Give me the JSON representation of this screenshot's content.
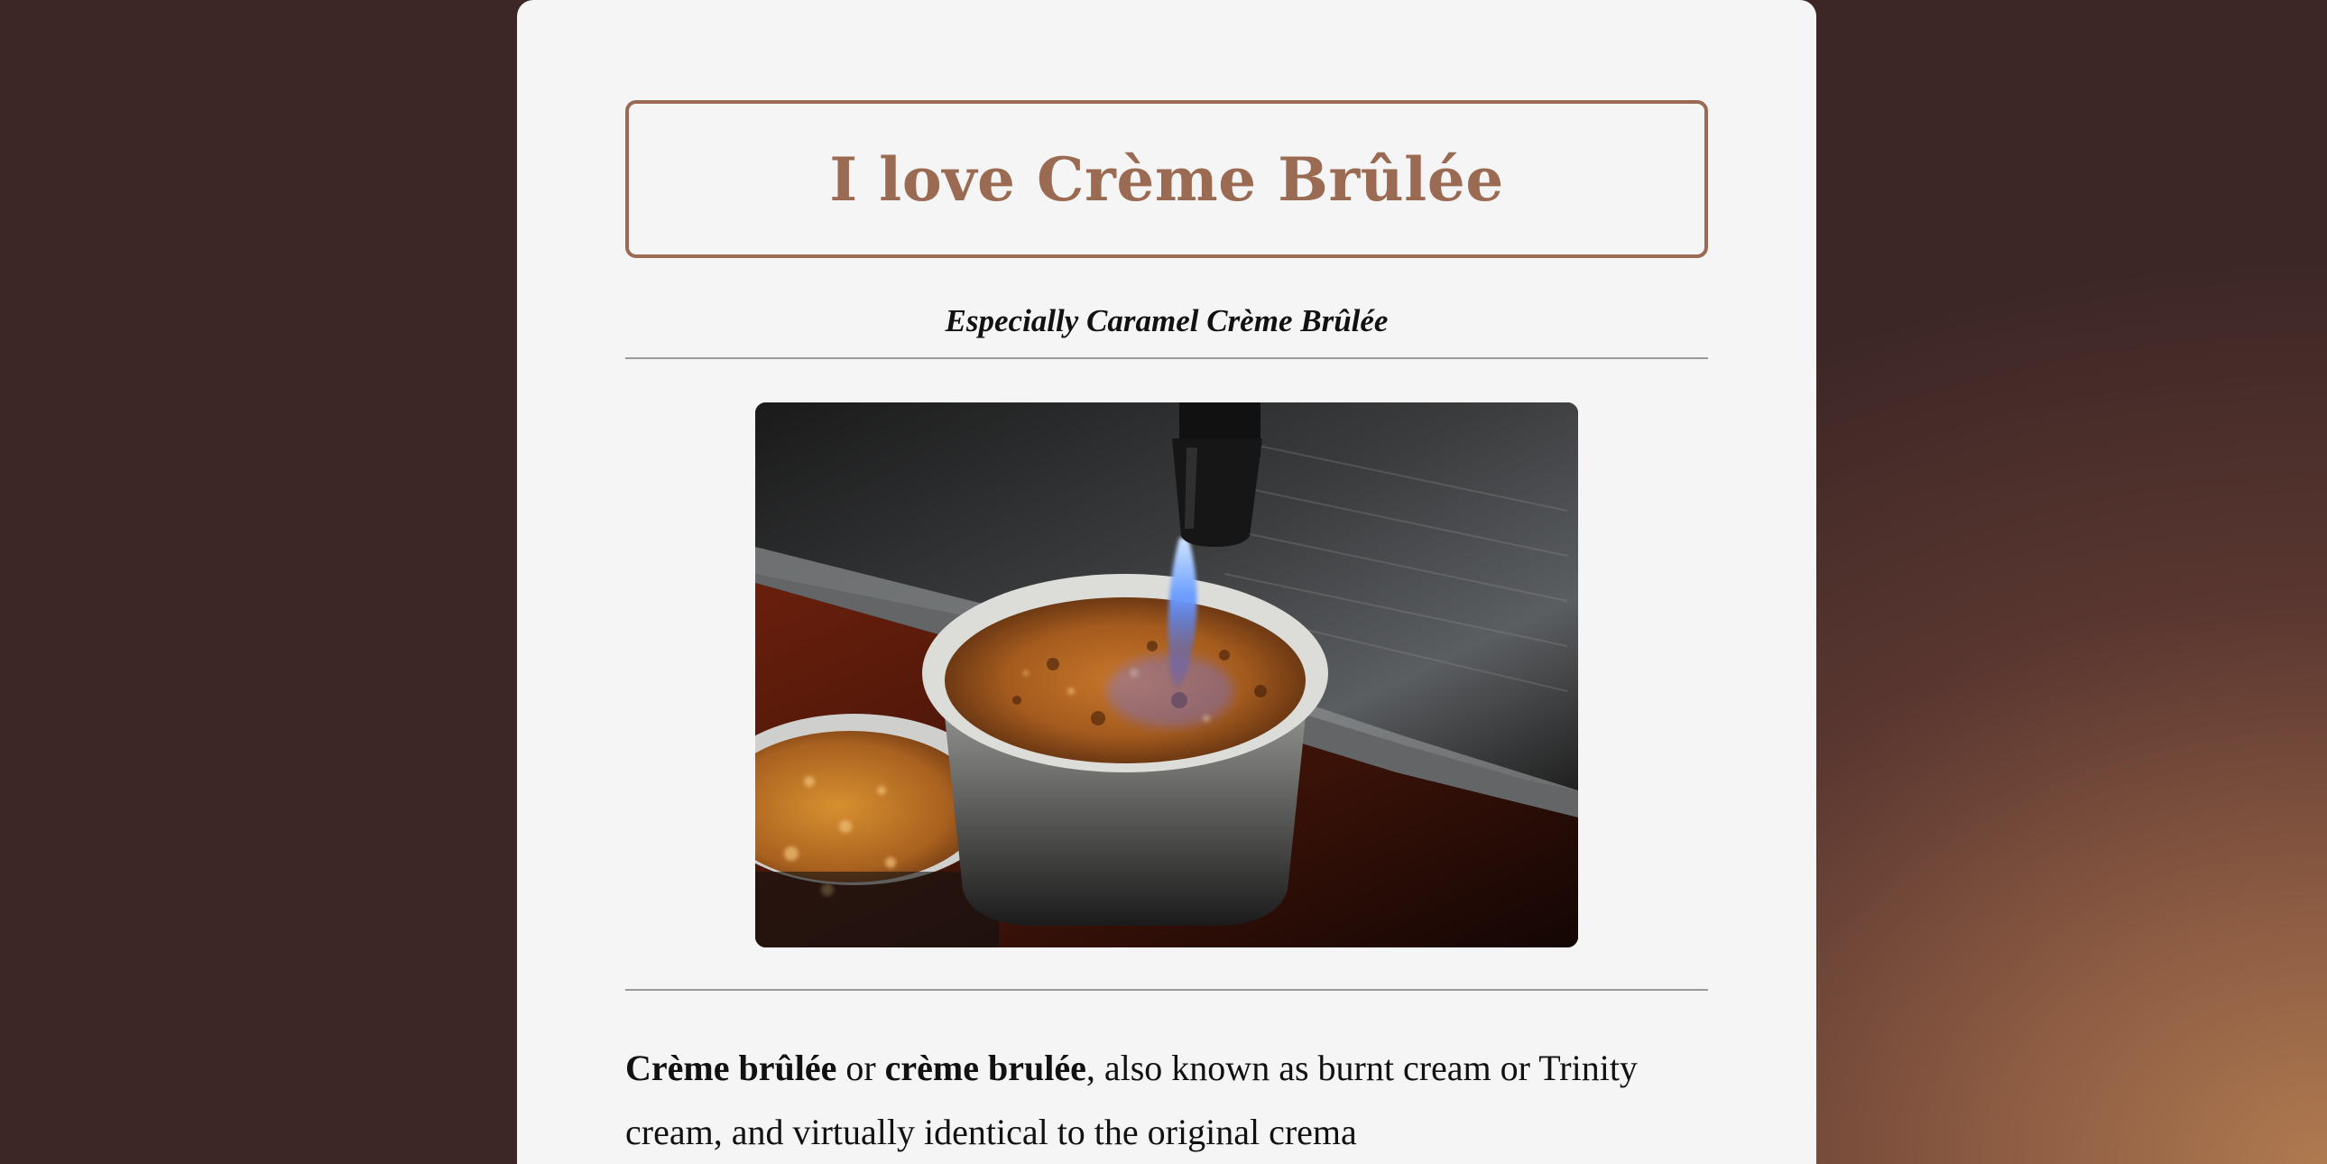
{
  "page": {
    "title": "I love Crème Brûlée",
    "subtitle": "Especially Caramel Crème Brûlée",
    "image_alt": "Blowtorch caramelizing crème brûlée",
    "intro": {
      "term1": "Crème brûlée",
      "connector": " or ",
      "term2": "crème brulée",
      "rest": ", also known as burnt cream or Trinity cream, and virtually identical to the original crema"
    }
  },
  "colors": {
    "background": "#3d2726",
    "card": "#f5f5f5",
    "accent": "#9a6b52",
    "text": "#111111",
    "rule": "#9a9a9a"
  },
  "icons": {
    "photo": "creme-brulee-torch-photo"
  }
}
